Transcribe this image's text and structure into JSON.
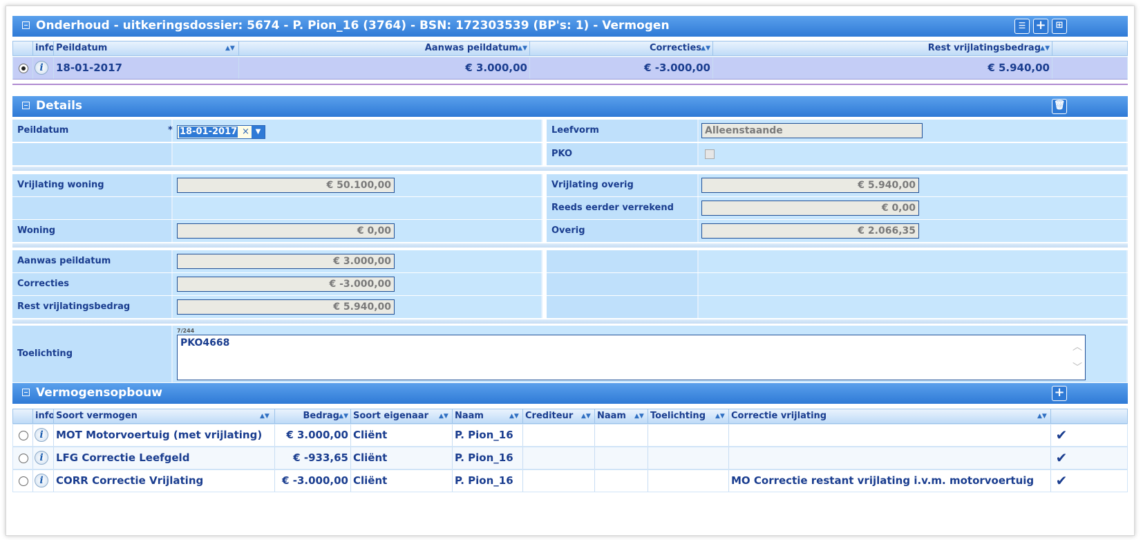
{
  "top_section": {
    "title": "Onderhoud - uitkeringsdossier: 5674 - P. Pion_16 (3764) - BSN: 172303539 (BP's: 1) - Vermogen",
    "columns": [
      "info",
      "Peildatum",
      "Aanwas peildatum",
      "Correcties",
      "Rest vrijlatingsbedrag"
    ],
    "row": {
      "peildatum": "18-01-2017",
      "aanwas": "€ 3.000,00",
      "correcties": "€ -3.000,00",
      "rest": "€ 5.940,00"
    },
    "icons": [
      "list-icon",
      "plus-icon",
      "add-row-icon"
    ]
  },
  "details": {
    "title": "Details",
    "peildatum_label": "Peildatum",
    "required_mark": "*",
    "peildatum_value": "18-01-2017",
    "clear_glyph": "×",
    "leefvorm_label": "Leefvorm",
    "leefvorm_value": "Alleenstaande",
    "pko_label": "PKO",
    "vrijlating_woning_label": "Vrijlating woning",
    "vrijlating_woning_value": "€ 50.100,00",
    "vrijlating_overig_label": "Vrijlating overig",
    "vrijlating_overig_value": "€ 5.940,00",
    "reeds_label": "Reeds eerder verrekend",
    "reeds_value": "€ 0,00",
    "woning_label": "Woning",
    "woning_value": "€ 0,00",
    "overig_label": "Overig",
    "overig_value": "€ 2.066,35",
    "aanwas_label": "Aanwas peildatum",
    "aanwas_value": "€ 3.000,00",
    "correcties_label": "Correcties",
    "correcties_value": "€ -3.000,00",
    "rest_label": "Rest vrijlatingsbedrag",
    "rest_value": "€ 5.940,00",
    "toelichting_label": "Toelichting",
    "toelichting_counter": "7/244",
    "toelichting_value": "PKO4668"
  },
  "vermogen": {
    "title": "Vermogensopbouw",
    "columns": [
      "info",
      "Soort vermogen",
      "Bedrag",
      "Soort eigenaar",
      "Naam",
      "Crediteur",
      "Naam",
      "Toelichting",
      "Correctie vrijlating"
    ],
    "rows": [
      {
        "soort": "MOT Motorvoertuig (met vrijlating)",
        "bedrag": "€ 3.000,00",
        "eigenaar": "Cliënt",
        "naam": "P. Pion_16",
        "crediteur": "",
        "naam2": "",
        "toelichting": "",
        "correctie": ""
      },
      {
        "soort": "LFG Correctie Leefgeld",
        "bedrag": "€ -933,65",
        "eigenaar": "Cliënt",
        "naam": "P. Pion_16",
        "crediteur": "",
        "naam2": "",
        "toelichting": "",
        "correctie": ""
      },
      {
        "soort": "CORR Correctie Vrijlating",
        "bedrag": "€ -3.000,00",
        "eigenaar": "Cliënt",
        "naam": "P. Pion_16",
        "crediteur": "",
        "naam2": "",
        "toelichting": "",
        "correctie": "MO Correctie restant vrijlating i.v.m. motorvoertuig"
      }
    ],
    "check_glyph": "✔"
  }
}
